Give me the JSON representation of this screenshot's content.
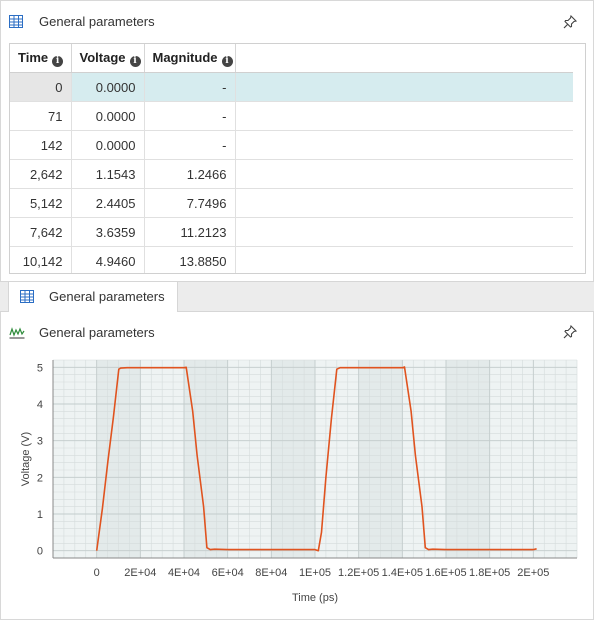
{
  "table_panel": {
    "title": "General parameters",
    "columns": [
      "Time",
      "Voltage",
      "Magnitude"
    ],
    "rows": [
      [
        "0",
        "0.0000",
        "-"
      ],
      [
        "71",
        "0.0000",
        "-"
      ],
      [
        "142",
        "0.0000",
        "-"
      ],
      [
        "2,642",
        "1.1543",
        "1.2466"
      ],
      [
        "5,142",
        "2.4405",
        "7.7496"
      ],
      [
        "7,642",
        "3.6359",
        "11.2123"
      ],
      [
        "10,142",
        "4.9460",
        "13.8850"
      ]
    ],
    "selected_row": 0
  },
  "tab": {
    "label": "General parameters"
  },
  "chart_panel": {
    "title": "General parameters"
  },
  "colors": {
    "line": "#e0531f",
    "selection": "#d6ecef",
    "plot_bg": "#eef3f3"
  },
  "chart_data": {
    "type": "line",
    "title": "",
    "xlabel": "Time (ps)",
    "ylabel": "Voltage (V)",
    "xlim": [
      -20000,
      220000
    ],
    "ylim": [
      -0.2,
      5.2
    ],
    "grid": true,
    "x_ticks": [
      "0",
      "2E+04",
      "4E+04",
      "6E+04",
      "8E+04",
      "1E+05",
      "1.2E+05",
      "1.4E+05",
      "1.6E+05",
      "1.8E+05",
      "2E+05"
    ],
    "x_tick_values": [
      0,
      20000,
      40000,
      60000,
      80000,
      100000,
      120000,
      140000,
      160000,
      180000,
      200000
    ],
    "y_ticks": [
      "0",
      "1",
      "2",
      "3",
      "4",
      "5"
    ],
    "y_tick_values": [
      0,
      1,
      2,
      3,
      4,
      5
    ],
    "series": [
      {
        "x": [
          0,
          2642,
          5142,
          7642,
          10142,
          11000,
          14000,
          40000,
          41000,
          44000,
          46000,
          49000,
          50500,
          52000,
          54000,
          60000,
          100000,
          101500,
          103000,
          105000,
          107500,
          110000,
          111500,
          114000,
          140000,
          141000,
          144000,
          146000,
          149000,
          150500,
          152000,
          154000,
          160000,
          200000,
          201500
        ],
        "y": [
          0,
          1.15,
          2.44,
          3.64,
          4.95,
          4.98,
          4.99,
          4.99,
          5.0,
          3.8,
          2.6,
          1.2,
          0.08,
          0.03,
          0.04,
          0.03,
          0.03,
          0.0,
          0.5,
          2.0,
          3.6,
          4.95,
          4.99,
          4.99,
          4.99,
          5.01,
          3.8,
          2.6,
          1.2,
          0.08,
          0.03,
          0.04,
          0.03,
          0.03,
          0.05
        ]
      }
    ]
  }
}
